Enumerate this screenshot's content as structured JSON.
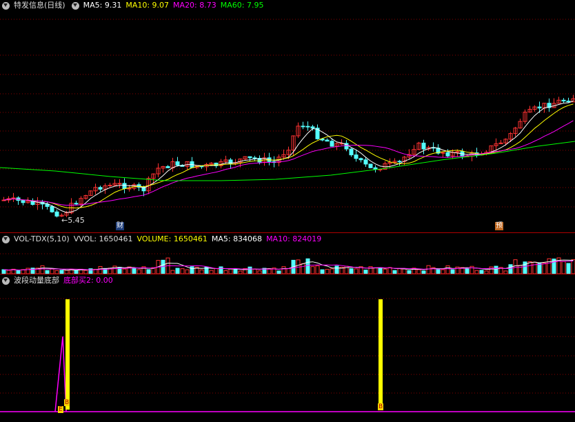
{
  "main": {
    "title": "特发信息(日线)",
    "indicators": [
      {
        "label": "MA5:",
        "value": "9.31",
        "color": "#ffffff"
      },
      {
        "label": "MA10:",
        "value": "9.07",
        "color": "#ffff00"
      },
      {
        "label": "MA20:",
        "value": "8.73",
        "color": "#ff00ff"
      },
      {
        "label": "MA60:",
        "value": "7.95",
        "color": "#00ff00"
      }
    ],
    "low_marker": "←5.45",
    "event_tag_1": "财",
    "event_tag_2": "预"
  },
  "volume": {
    "title": "VOL-TDX(5,10)",
    "vvol_label": "VVOL:",
    "vvol_value": "1650461",
    "volume_label": "VOLUME:",
    "volume_value": "1650461",
    "ma5_label": "MA5:",
    "ma5_value": "834068",
    "ma10_label": "MA10:",
    "ma10_value": "824019"
  },
  "indicator": {
    "title": "波段动量底部",
    "signal_label": "底部买2:",
    "signal_value": "0.00",
    "marker_e": "E",
    "marker_b": "B"
  },
  "colors": {
    "up": "#ff3232",
    "down": "#54ffff",
    "ma5": "#ffffff",
    "ma10": "#ffff00",
    "ma20": "#ff00ff",
    "ma60": "#00ff00",
    "grid": "#8b0000"
  }
}
